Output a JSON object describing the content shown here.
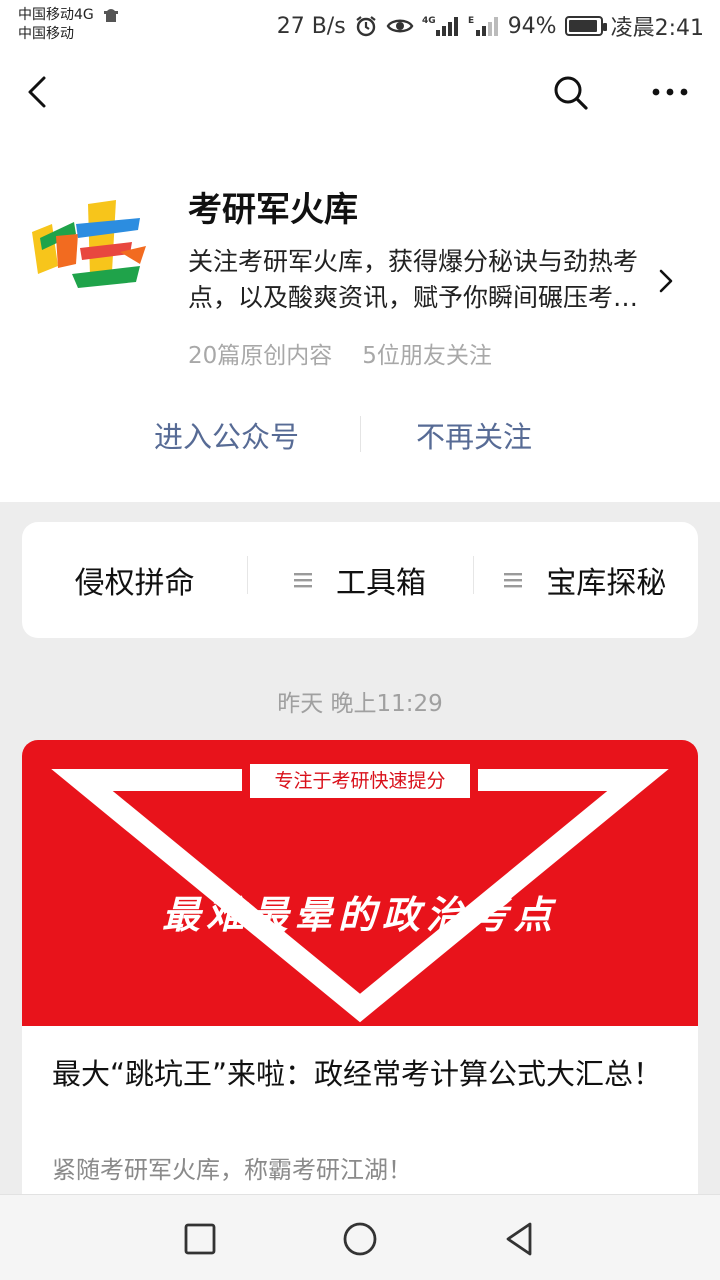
{
  "status_bar": {
    "carrier_line1": "中国移动4G",
    "carrier_line2": "中国移动",
    "net_speed": "27 B/s",
    "battery_percent": "94%",
    "battery_level": 0.94,
    "time": "凌晨2:41",
    "icons": [
      "ghost-icon",
      "alarm-icon",
      "eye-icon",
      "signal-4g-icon",
      "signal-e-icon",
      "battery-icon"
    ]
  },
  "nav": {
    "icons": [
      "back-icon",
      "search-icon",
      "more-icon"
    ]
  },
  "profile": {
    "name": "考研军火库",
    "description": "关注考研军火库，获得爆分秘诀与劲热考点，以及酸爽资讯，赋予你瞬间碾压考研的力量！",
    "stats": {
      "original_count": "20篇原创内容",
      "friends_following": "5位朋友关注"
    },
    "actions": {
      "enter": "进入公众号",
      "unfollow": "不再关注"
    }
  },
  "menu": {
    "items": [
      {
        "label": "侵权拼命"
      },
      {
        "label": "工具箱",
        "icon": "menu-lines-icon"
      },
      {
        "label": "宝库探秘",
        "icon": "menu-lines-icon"
      }
    ]
  },
  "feed": {
    "timestamp": "昨天 晚上11:29",
    "article": {
      "cover_tag": "专注于考研快速提分",
      "cover_title": "最难最晕的政治考点",
      "cover_color": "#e8131b",
      "title": "最大“跳坑王”来啦：政经常考计算公式大汇总！",
      "subtitle": "紧随考研军火库，称霸考研江湖！"
    }
  },
  "system_nav": {
    "icons": [
      "recent-apps-icon",
      "home-icon",
      "system-back-icon"
    ]
  },
  "colors": {
    "link": "#576b95",
    "feed_bg": "#ededed",
    "muted": "#a8a8a8"
  }
}
